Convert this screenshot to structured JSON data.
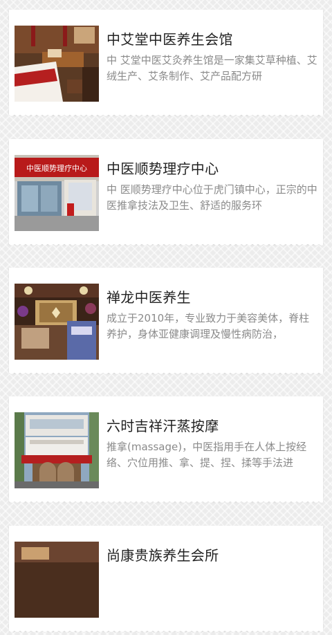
{
  "venues": [
    {
      "title": "中艾堂中医养生会馆",
      "description": "中 艾堂中医艾灸养生馆是一家集艾草种植、艾绒生产、艾条制作、艾产品配方研",
      "image": "spa-lounge-photo"
    },
    {
      "title": "中医顺势理疗中心",
      "description": "中 医顺势理疗中心位于虎门镇中心，正宗的中医推拿技法及卫生、舒适的服务环",
      "image": "storefront-photo",
      "sign_text": "中医顺势理疗中心"
    },
    {
      "title": "禅龙中医养生",
      "description": "成立于2010年，专业致力于美容美体，脊柱养护，身体亚健康调理及慢性病防治，",
      "image": "reception-photo"
    },
    {
      "title": "六时吉祥汗蒸按摩",
      "description": "推拿(massage)，中医指用手在人体上按经络、穴位用推、拿、提、捏、揉等手法进",
      "image": "building-photo"
    },
    {
      "title": "尚康贵族养生会所",
      "description": "",
      "image": "interior-photo"
    }
  ]
}
